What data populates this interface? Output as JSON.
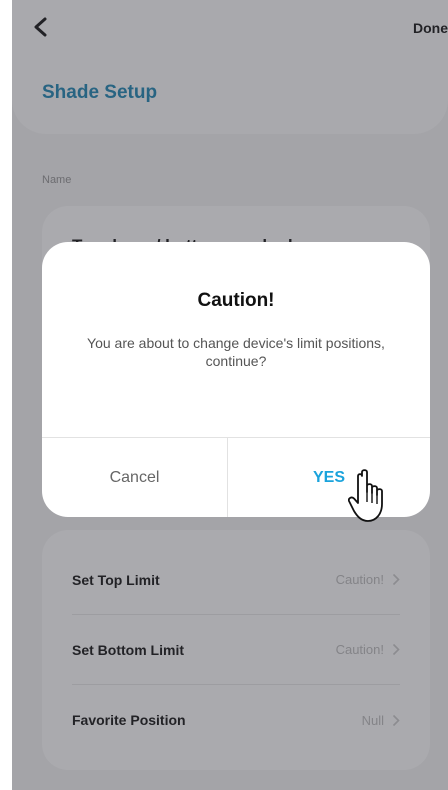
{
  "header": {
    "done_label": "Done",
    "title": "Shade Setup"
  },
  "name_section": {
    "label": "Name",
    "value": "Top down / bottom up shade"
  },
  "limits": [
    {
      "label": "Set Top Limit",
      "value": "Caution!"
    },
    {
      "label": "Set Bottom Limit",
      "value": "Caution!"
    },
    {
      "label": "Favorite Position",
      "value": "Null"
    }
  ],
  "dialog": {
    "title": "Caution!",
    "message": "You are about to change device's limit positions, continue?",
    "cancel_label": "Cancel",
    "yes_label": "YES"
  },
  "colors": {
    "accent": "#1b7fab",
    "yes": "#1aa3dc",
    "background": "#e9e9e9"
  },
  "icons": [
    "back-chevron-icon",
    "chevron-right-icon",
    "hand-pointer-icon"
  ]
}
